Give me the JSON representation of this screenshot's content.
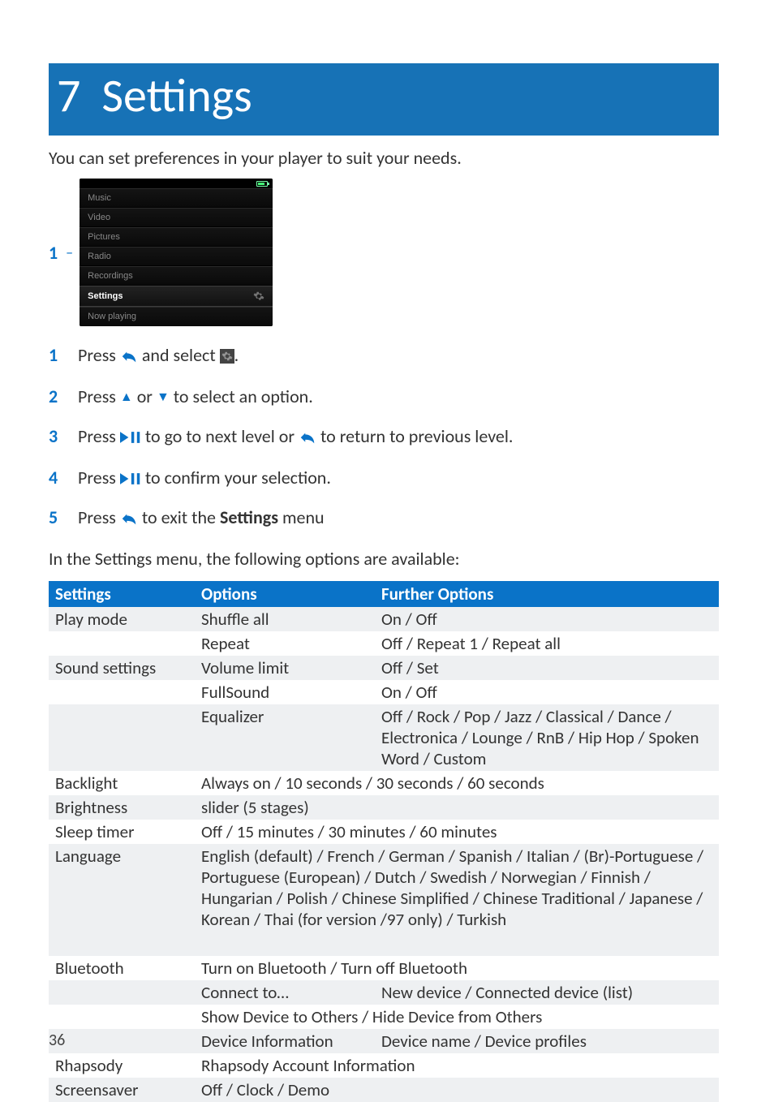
{
  "chapter": {
    "number": "7",
    "title": "Settings"
  },
  "intro": "You can set preferences in your player to suit your needs.",
  "device_marker": "1",
  "device_menu": [
    "Music",
    "Video",
    "Pictures",
    "Radio",
    "Recordings",
    "Settings",
    "Now playing"
  ],
  "device_selected_index": 5,
  "steps": [
    {
      "n": "1",
      "pre": "Press ",
      "icon1": "back",
      "mid": " and select ",
      "icon2": "cog",
      "post": "."
    },
    {
      "n": "2",
      "pre": "Press ",
      "icon1": "up",
      "mid": " or ",
      "icon2": "down",
      "post": " to select an option."
    },
    {
      "n": "3",
      "pre": "Press ",
      "icon1": "play-pause",
      "mid": " to go to next level or ",
      "icon2": "back",
      "post": " to return to previous level."
    },
    {
      "n": "4",
      "pre": "Press ",
      "icon1": "play-pause",
      "mid": "",
      "icon2": "",
      "post": " to confirm your selection."
    },
    {
      "n": "5",
      "pre": "Press ",
      "icon1": "back",
      "mid": " to exit the ",
      "bold": "Settings",
      "post": " menu"
    }
  ],
  "subintro": "In the Settings menu, the following options are available:",
  "table_headers": [
    "Settings",
    "Options",
    "Further Options"
  ],
  "rows": [
    {
      "alt": true,
      "c1": "Play mode",
      "c2": "Shuffle all",
      "c3": "On / Off"
    },
    {
      "alt": false,
      "c1": "",
      "c2": "Repeat",
      "c3": "Off / Repeat 1 / Repeat all"
    },
    {
      "alt": true,
      "c1": "Sound settings",
      "c2": "Volume limit",
      "c3": "Off / Set"
    },
    {
      "alt": false,
      "c1": "",
      "c2": "FullSound",
      "c3": "On / Off"
    },
    {
      "alt": true,
      "c1": "",
      "c2": "Equalizer",
      "c3": "Off / Rock / Pop / Jazz / Classical / Dance / Electronica / Lounge / RnB / Hip Hop / Spoken Word / Custom"
    },
    {
      "alt": false,
      "c1": "Backlight",
      "span": true,
      "c23": "Always on / 10 seconds / 30 seconds / 60 seconds"
    },
    {
      "alt": true,
      "c1": "Brightness",
      "span": true,
      "c23": "slider (5 stages)"
    },
    {
      "alt": false,
      "c1": "Sleep timer",
      "span": true,
      "c23": "Off / 15 minutes / 30 minutes / 60 minutes"
    },
    {
      "alt": true,
      "c1": "Language",
      "span": true,
      "c23": "English (default) / French / German / Spanish / Italian / (Br)-Portuguese / Portuguese (European) / Dutch / Swedish / Norwegian / Finnish / Hungarian / Polish / Chinese Simplified / Chinese Traditional / Japanese / Korean / Thai (for version /97 only) / Turkish"
    },
    {
      "alt": true,
      "c1": "",
      "span": true,
      "c23": " "
    },
    {
      "alt": false,
      "c1": "Bluetooth",
      "span": true,
      "c23": "Turn on Bluetooth / Turn off Bluetooth"
    },
    {
      "alt": true,
      "c1": "",
      "c2": "Connect to…",
      "c3": "New device / Connected device (list)"
    },
    {
      "alt": false,
      "c1": "",
      "span": true,
      "c23": "Show Device to Others / Hide Device from Others"
    },
    {
      "alt": true,
      "c1": "",
      "c2": "Device Information",
      "c3": "Device name / Device profiles"
    },
    {
      "alt": false,
      "c1": "Rhapsody",
      "span": true,
      "c23": "Rhapsody Account Information"
    },
    {
      "alt": true,
      "c1": "Screensaver",
      "span": true,
      "c23": "Off / Clock / Demo"
    }
  ],
  "page_number": "36"
}
